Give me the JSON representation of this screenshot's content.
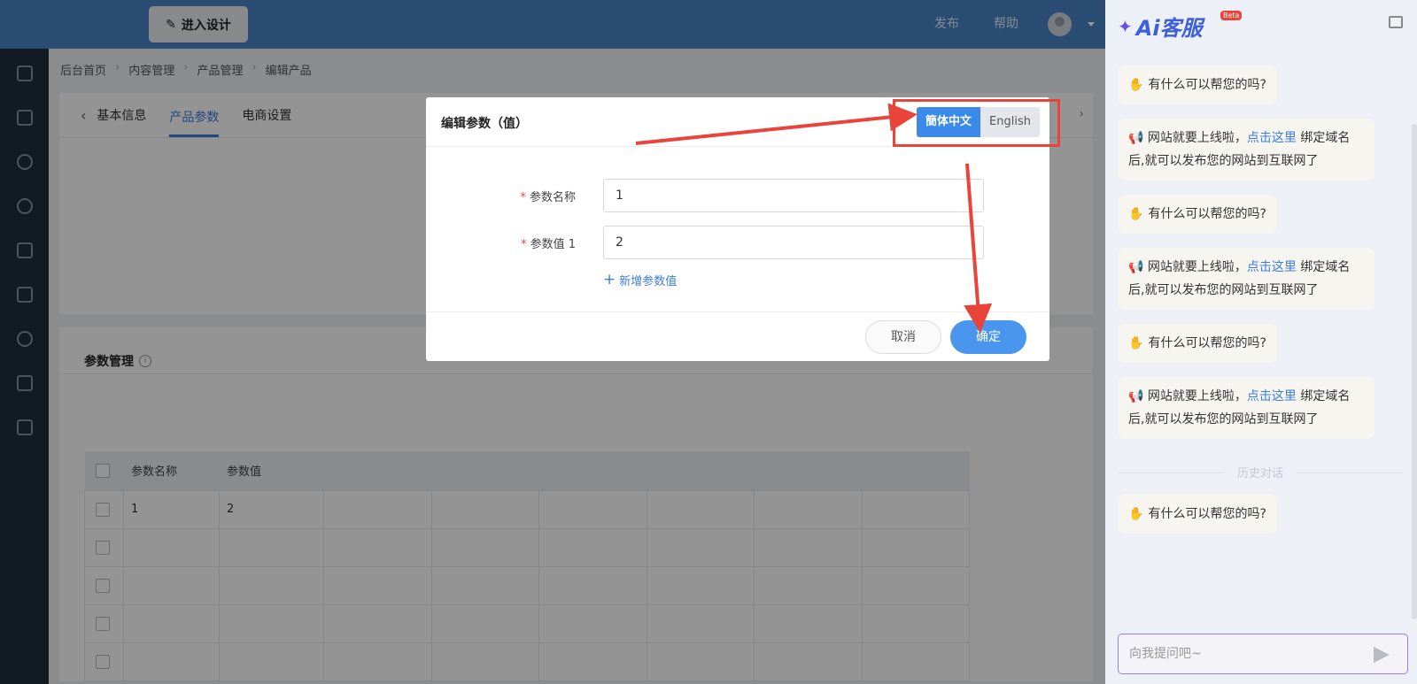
{
  "header": {
    "design_button": "进入设计",
    "publish": "发布",
    "help": "帮助"
  },
  "breadcrumb": [
    "后台首页",
    "内容管理",
    "产品管理",
    "编辑产品"
  ],
  "tabs": [
    "基本信息",
    "产品参数",
    "电商设置"
  ],
  "param_section": {
    "title": "参数管理",
    "columns": [
      "参数名称",
      "参数值"
    ],
    "rows": [
      [
        "1",
        "2"
      ]
    ]
  },
  "modal": {
    "title": "编辑参数（值）",
    "lang_active": "簡体中文",
    "lang_inactive": "English",
    "field1_label": "参数名称",
    "field1_value": "1",
    "field2_label": "参数值 1",
    "field2_value": "2",
    "add_value": "新增参数值",
    "cancel": "取消",
    "ok": "确定"
  },
  "ai": {
    "logo": "Ai客服",
    "beta": "Beta",
    "greeting": "有什么可以帮您的吗?",
    "notice_pre": "网站就要上线啦，",
    "notice_link": "点击这里",
    "notice_post": "绑定域名后,就可以发布您的网站到互联网了",
    "history": "历史对话",
    "input_placeholder": "向我提问吧~"
  },
  "colors": {
    "header_bg": "#4a86c8",
    "sidebar_bg": "#1f2d3d",
    "accent": "#3b7ddd",
    "annotation_red": "#e8443a"
  }
}
